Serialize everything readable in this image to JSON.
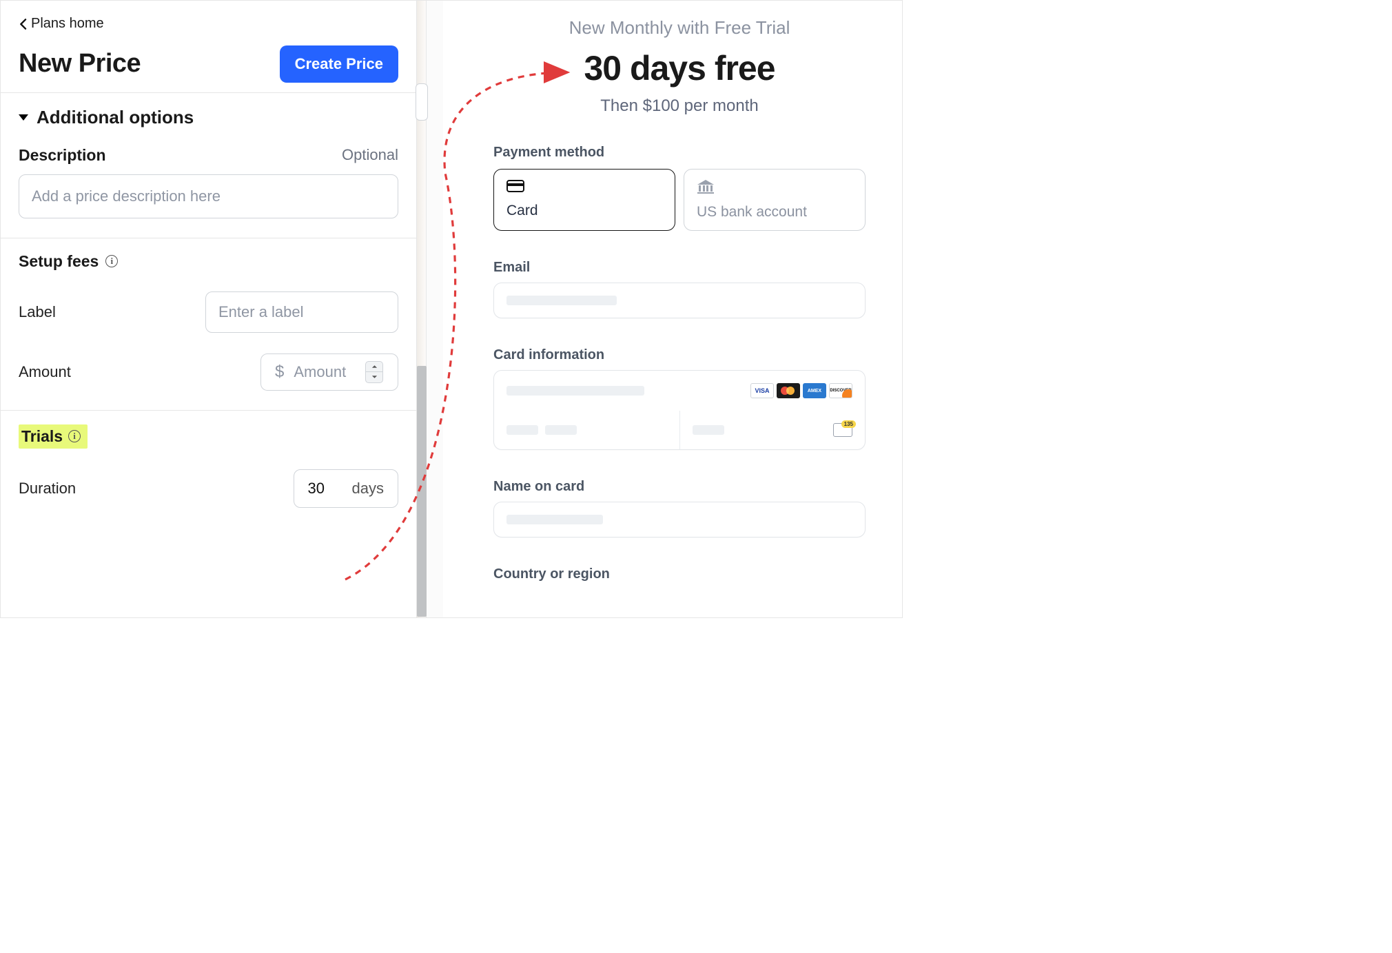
{
  "left": {
    "breadcrumb": "Plans home",
    "title": "New Price",
    "create_button": "Create Price",
    "disclosure_label": "Additional options",
    "description": {
      "label": "Description",
      "optional": "Optional",
      "placeholder": "Add a price description here"
    },
    "setup_fees": {
      "heading": "Setup fees",
      "label_field": {
        "label": "Label",
        "placeholder": "Enter a label"
      },
      "amount_field": {
        "label": "Amount",
        "currency": "$",
        "placeholder": "Amount"
      }
    },
    "trials": {
      "heading": "Trials",
      "duration": {
        "label": "Duration",
        "value": "30",
        "unit": "days"
      }
    }
  },
  "right": {
    "subtitle": "New Monthly with Free Trial",
    "headline": "30 days free",
    "then_line": "Then $100 per month",
    "payment_method_label": "Payment method",
    "pm_card": "Card",
    "pm_bank": "US bank account",
    "email_label": "Email",
    "card_info_label": "Card information",
    "name_label": "Name on card",
    "country_label": "Country or region",
    "brand_visa": "VISA",
    "brand_amex": "AMEX",
    "brand_disc": "DISCOVER",
    "cvc_badge": "135"
  }
}
